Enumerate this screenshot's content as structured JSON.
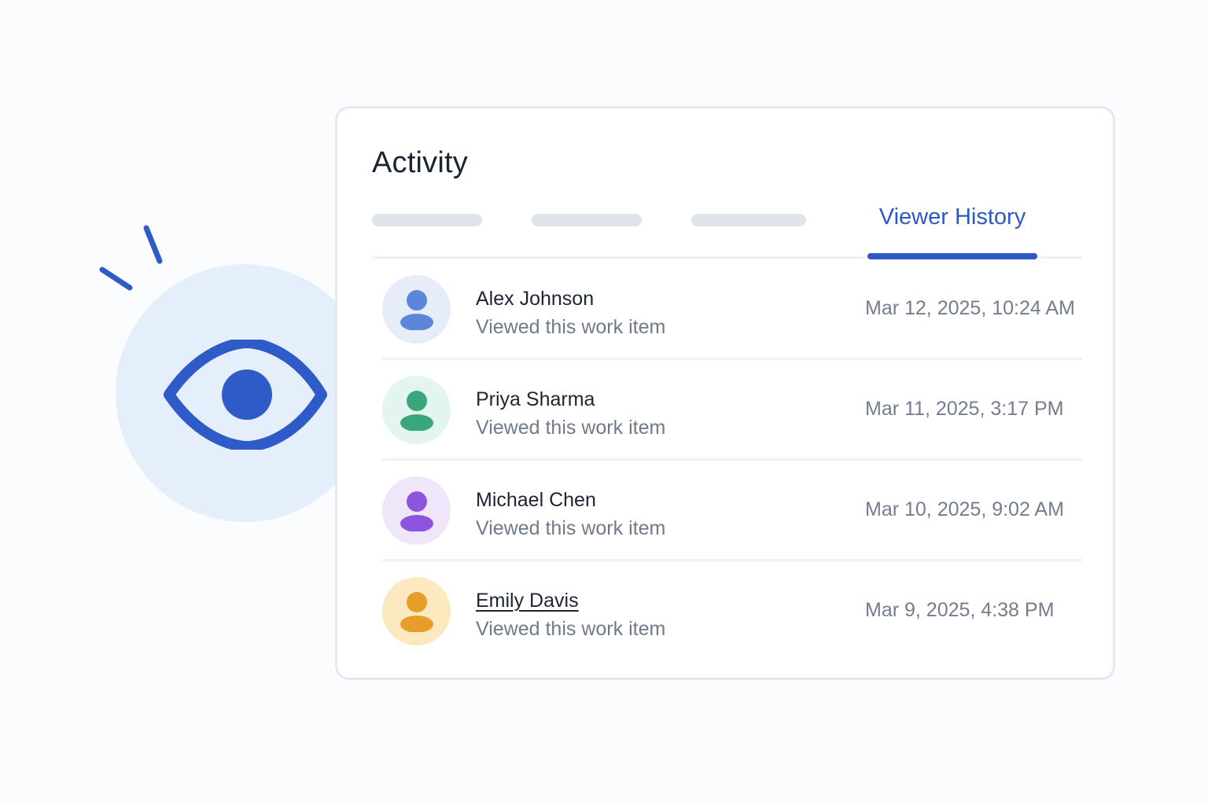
{
  "colors": {
    "accent": "#2e59c5",
    "eye_circle_bg": "#e5effc",
    "eye_icon": "#2e5bc7"
  },
  "illustration": {
    "icon": "eye-icon"
  },
  "activity": {
    "title": "Activity",
    "tabs": [
      {
        "label": "",
        "placeholder": true
      },
      {
        "label": "",
        "placeholder": true
      },
      {
        "label": "",
        "placeholder": true
      },
      {
        "label": "Viewer History",
        "active": true
      }
    ],
    "viewers": [
      {
        "name": "Alex Johnson",
        "action": "Viewed this work item",
        "timestamp": "Mar 12, 2025, 10:24 AM",
        "icon": "user-icon",
        "avatar_bg": "#e6edf9",
        "avatar_fg": "#5b86dc"
      },
      {
        "name": "Priya Sharma",
        "action": "Viewed this work item",
        "timestamp": "Mar 11, 2025, 3:17 PM",
        "icon": "user-icon",
        "avatar_bg": "#e3f5ee",
        "avatar_fg": "#3aa77b"
      },
      {
        "name": "Michael Chen",
        "action": "Viewed this work item",
        "timestamp": "Mar 10, 2025, 9:02 AM",
        "icon": "user-icon",
        "avatar_bg": "#efe6fa",
        "avatar_fg": "#8d55df"
      },
      {
        "name": "Emily Davis",
        "action": "Viewed this work item",
        "timestamp": "Mar 9, 2025, 4:38 PM",
        "icon": "user-icon",
        "avatar_bg": "#fde9bf",
        "avatar_fg": "#e79d2a",
        "underlined": true
      }
    ]
  }
}
